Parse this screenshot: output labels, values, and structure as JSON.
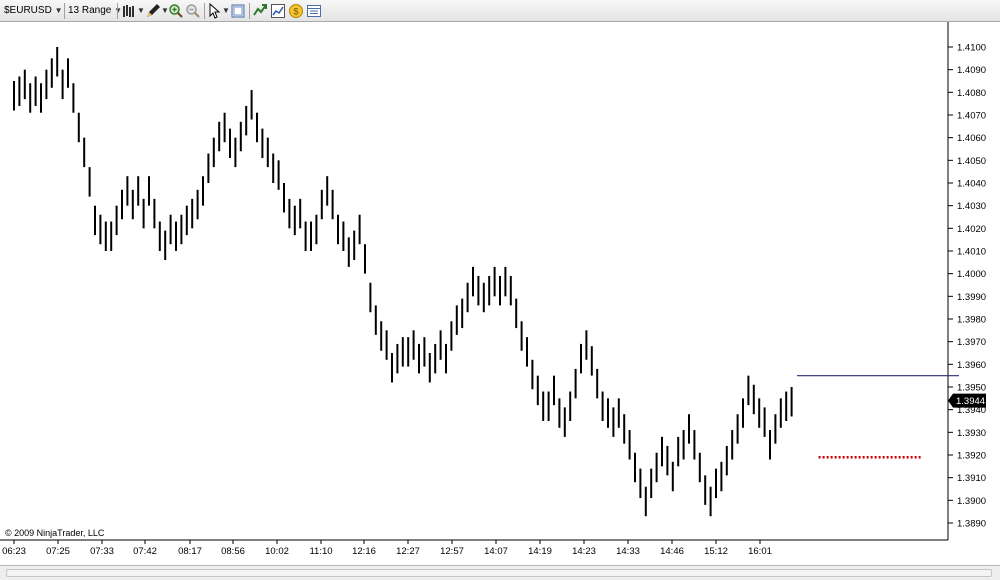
{
  "toolbar": {
    "instrument": "$EURUSD",
    "period": "13 Range",
    "icons": [
      "bar-type-icon",
      "drawing-pencil-icon",
      "zoom-in-icon",
      "zoom-out-icon",
      "pointer-cursor-icon",
      "properties-icon",
      "strategies-icon",
      "chart-trader-icon",
      "price-ladder-icon",
      "data-box-icon"
    ]
  },
  "copyright": "© 2009 NinjaTrader, LLC",
  "current_price": "1.3944",
  "colors": {
    "bars": "#000000",
    "price_marker_bg": "#000000",
    "upper_line": "#2b2b7a",
    "stop_line": "#cc0000"
  },
  "chart_data": {
    "type": "ohlc-range-bars",
    "instrument": "$EURUSD",
    "ylim": [
      1.3885,
      1.4113
    ],
    "y_ticks": [
      "1.3890",
      "1.3900",
      "1.3910",
      "1.3920",
      "1.3930",
      "1.3940",
      "1.3950",
      "1.3960",
      "1.3970",
      "1.3980",
      "1.3990",
      "1.4000",
      "1.4010",
      "1.4020",
      "1.4030",
      "1.4040",
      "1.4050",
      "1.4060",
      "1.4070",
      "1.4080",
      "1.4090",
      "1.4100"
    ],
    "x_ticks": [
      "06:23",
      "07:25",
      "07:33",
      "07:42",
      "08:17",
      "08:56",
      "10:02",
      "11:10",
      "12:16",
      "12:27",
      "12:57",
      "14:07",
      "14:19",
      "14:23",
      "14:33",
      "14:46",
      "15:12",
      "16:01"
    ],
    "bars": [
      [
        1.4072,
        1.4085
      ],
      [
        1.4074,
        1.4087
      ],
      [
        1.4077,
        1.409
      ],
      [
        1.4071,
        1.4084
      ],
      [
        1.4074,
        1.4087
      ],
      [
        1.4071,
        1.4084
      ],
      [
        1.4077,
        1.409
      ],
      [
        1.4082,
        1.4095
      ],
      [
        1.4087,
        1.41
      ],
      [
        1.4077,
        1.409
      ],
      [
        1.4082,
        1.4095
      ],
      [
        1.4071,
        1.4084
      ],
      [
        1.4058,
        1.4071
      ],
      [
        1.4047,
        1.406
      ],
      [
        1.4034,
        1.4047
      ],
      [
        1.4017,
        1.403
      ],
      [
        1.4013,
        1.4026
      ],
      [
        1.401,
        1.4023
      ],
      [
        1.401,
        1.4023
      ],
      [
        1.4017,
        1.403
      ],
      [
        1.4024,
        1.4037
      ],
      [
        1.403,
        1.4043
      ],
      [
        1.4024,
        1.4037
      ],
      [
        1.403,
        1.4043
      ],
      [
        1.402,
        1.4033
      ],
      [
        1.403,
        1.4043
      ],
      [
        1.402,
        1.4033
      ],
      [
        1.401,
        1.4023
      ],
      [
        1.4006,
        1.4019
      ],
      [
        1.4013,
        1.4026
      ],
      [
        1.401,
        1.4023
      ],
      [
        1.4013,
        1.4026
      ],
      [
        1.4017,
        1.403
      ],
      [
        1.402,
        1.4033
      ],
      [
        1.4024,
        1.4037
      ],
      [
        1.403,
        1.4043
      ],
      [
        1.404,
        1.4053
      ],
      [
        1.4047,
        1.406
      ],
      [
        1.4054,
        1.4067
      ],
      [
        1.4058,
        1.4071
      ],
      [
        1.4051,
        1.4064
      ],
      [
        1.4047,
        1.406
      ],
      [
        1.4054,
        1.4067
      ],
      [
        1.4061,
        1.4074
      ],
      [
        1.4068,
        1.4081
      ],
      [
        1.4058,
        1.4071
      ],
      [
        1.4051,
        1.4064
      ],
      [
        1.4047,
        1.406
      ],
      [
        1.404,
        1.4053
      ],
      [
        1.4037,
        1.405
      ],
      [
        1.4027,
        1.404
      ],
      [
        1.402,
        1.4033
      ],
      [
        1.4017,
        1.403
      ],
      [
        1.402,
        1.4033
      ],
      [
        1.401,
        1.4023
      ],
      [
        1.401,
        1.4023
      ],
      [
        1.4013,
        1.4026
      ],
      [
        1.4024,
        1.4037
      ],
      [
        1.403,
        1.4043
      ],
      [
        1.4024,
        1.4037
      ],
      [
        1.4013,
        1.4026
      ],
      [
        1.401,
        1.4023
      ],
      [
        1.4003,
        1.4016
      ],
      [
        1.4006,
        1.4019
      ],
      [
        1.4013,
        1.4026
      ],
      [
        1.4,
        1.4013
      ],
      [
        1.3983,
        1.3996
      ],
      [
        1.3973,
        1.3986
      ],
      [
        1.3966,
        1.3979
      ],
      [
        1.3962,
        1.3975
      ],
      [
        1.3952,
        1.3965
      ],
      [
        1.3956,
        1.3969
      ],
      [
        1.3959,
        1.3972
      ],
      [
        1.3959,
        1.3972
      ],
      [
        1.3962,
        1.3975
      ],
      [
        1.3956,
        1.3969
      ],
      [
        1.3959,
        1.3972
      ],
      [
        1.3952,
        1.3965
      ],
      [
        1.3956,
        1.3969
      ],
      [
        1.3962,
        1.3975
      ],
      [
        1.3956,
        1.3969
      ],
      [
        1.3966,
        1.3979
      ],
      [
        1.3973,
        1.3986
      ],
      [
        1.3976,
        1.3989
      ],
      [
        1.3983,
        1.3996
      ],
      [
        1.399,
        1.4003
      ],
      [
        1.3986,
        1.3999
      ],
      [
        1.3983,
        1.3996
      ],
      [
        1.3986,
        1.3999
      ],
      [
        1.399,
        1.4003
      ],
      [
        1.3986,
        1.3999
      ],
      [
        1.399,
        1.4003
      ],
      [
        1.3986,
        1.3999
      ],
      [
        1.3976,
        1.3989
      ],
      [
        1.3966,
        1.3979
      ],
      [
        1.3959,
        1.3972
      ],
      [
        1.3949,
        1.3962
      ],
      [
        1.3942,
        1.3955
      ],
      [
        1.3935,
        1.3948
      ],
      [
        1.3935,
        1.3948
      ],
      [
        1.3942,
        1.3955
      ],
      [
        1.3932,
        1.3945
      ],
      [
        1.3928,
        1.3941
      ],
      [
        1.3935,
        1.3948
      ],
      [
        1.3945,
        1.3958
      ],
      [
        1.3956,
        1.3969
      ],
      [
        1.3962,
        1.3975
      ],
      [
        1.3955,
        1.3968
      ],
      [
        1.3945,
        1.3958
      ],
      [
        1.3935,
        1.3948
      ],
      [
        1.3932,
        1.3945
      ],
      [
        1.3928,
        1.3941
      ],
      [
        1.3932,
        1.3945
      ],
      [
        1.3925,
        1.3938
      ],
      [
        1.3918,
        1.3931
      ],
      [
        1.3908,
        1.3921
      ],
      [
        1.3901,
        1.3914
      ],
      [
        1.3893,
        1.3906
      ],
      [
        1.3901,
        1.3914
      ],
      [
        1.3908,
        1.3921
      ],
      [
        1.3915,
        1.3928
      ],
      [
        1.3911,
        1.3924
      ],
      [
        1.3904,
        1.3917
      ],
      [
        1.3915,
        1.3928
      ],
      [
        1.3918,
        1.3931
      ],
      [
        1.3925,
        1.3938
      ],
      [
        1.3918,
        1.3931
      ],
      [
        1.3908,
        1.3921
      ],
      [
        1.3898,
        1.3911
      ],
      [
        1.3893,
        1.3906
      ],
      [
        1.3901,
        1.3914
      ],
      [
        1.3904,
        1.3917
      ],
      [
        1.3911,
        1.3924
      ],
      [
        1.3918,
        1.3931
      ],
      [
        1.3925,
        1.3938
      ],
      [
        1.3932,
        1.3945
      ],
      [
        1.3942,
        1.3955
      ],
      [
        1.3938,
        1.3951
      ],
      [
        1.3932,
        1.3945
      ],
      [
        1.3928,
        1.3941
      ],
      [
        1.3918,
        1.3931
      ],
      [
        1.3925,
        1.3938
      ],
      [
        1.3932,
        1.3945
      ],
      [
        1.3935,
        1.3948
      ],
      [
        1.3937,
        1.395
      ]
    ],
    "horizontal_lines": [
      {
        "name": "upper-level",
        "y": 1.3955,
        "x_from_bar": 145,
        "x_to_bar": 175,
        "style": "solid"
      },
      {
        "name": "stop-level",
        "y": 1.3919,
        "x_from_bar": 149,
        "x_to_bar": 168,
        "style": "dotted"
      }
    ],
    "grid": false,
    "legend": "none"
  }
}
